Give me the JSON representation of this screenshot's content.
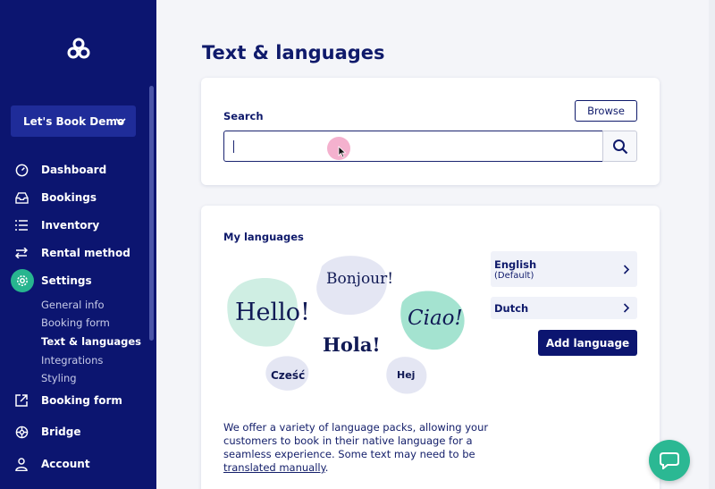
{
  "sidebar": {
    "account": "Let's Book Demo",
    "items": [
      {
        "label": "Dashboard",
        "icon": "gauge-icon"
      },
      {
        "label": "Bookings",
        "icon": "inbox-icon"
      },
      {
        "label": "Inventory",
        "icon": "list-icon"
      },
      {
        "label": "Rental method",
        "icon": "swap-icon"
      },
      {
        "label": "Settings",
        "icon": "gear-icon"
      },
      {
        "label": "Booking form",
        "icon": "external-link-icon"
      },
      {
        "label": "Bridge",
        "icon": "globe-icon"
      },
      {
        "label": "Account",
        "icon": "user-icon"
      }
    ],
    "settings_sub": [
      "General info",
      "Booking form",
      "Text & languages",
      "Integrations",
      "Styling"
    ],
    "current_sub": "Text & languages"
  },
  "main": {
    "title": "Text & languages",
    "search": {
      "label": "Search",
      "browse_label": "Browse",
      "value": "",
      "placeholder": ""
    },
    "languages": {
      "heading": "My languages",
      "list": [
        {
          "name": "English",
          "note": "(Default)"
        },
        {
          "name": "Dutch",
          "note": ""
        }
      ],
      "add_label": "Add language",
      "greetings": [
        "Hello!",
        "Bonjour!",
        "Ciao!",
        "Hola!",
        "Cześć",
        "Hej"
      ],
      "description": "We offer a variety of language packs, allowing your customers to book in their native language for a seamless experience. Some text may need to be ",
      "link_text": "translated manually",
      "description_end": "."
    }
  },
  "colors": {
    "sidebar_bg": "#0c1570",
    "accent": "#2bb893",
    "primary": "#0c1570",
    "page_bg": "#f4f5f9"
  }
}
